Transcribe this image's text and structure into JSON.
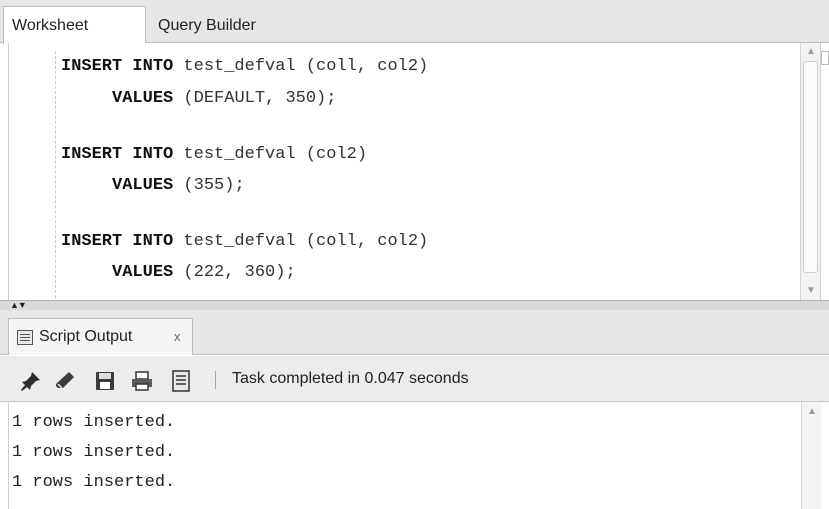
{
  "editor_tabs": [
    {
      "label": "Worksheet",
      "active": true
    },
    {
      "label": "Query Builder",
      "active": false
    }
  ],
  "code": [
    {
      "kw": "INSERT INTO",
      "rest": " test_defval (coll, col2)",
      "indent": ""
    },
    {
      "kw": "VALUES",
      "rest": " (DEFAULT, 350);",
      "indent": "     ",
      "kw2": "DEFAULT"
    },
    {
      "kw": "INSERT INTO",
      "rest": " test_defval (col2)",
      "indent": ""
    },
    {
      "kw": "VALUES",
      "rest": " (355);",
      "indent": "     "
    },
    {
      "kw": "INSERT INTO",
      "rest": " test_defval (coll, col2)",
      "indent": ""
    },
    {
      "kw": "VALUES",
      "rest": " (222, 360);",
      "indent": "     "
    }
  ],
  "output_tab": {
    "label": "Script Output",
    "close": "x",
    "icon": "script-output-icon"
  },
  "toolbar": {
    "icons": [
      "pin-icon",
      "eraser-icon",
      "save-icon",
      "print-icon",
      "document-icon"
    ],
    "status": "Task completed in 0.047 seconds"
  },
  "output_lines": [
    "1 rows inserted.",
    "1 rows inserted.",
    "1 rows inserted."
  ],
  "colors": {
    "chrome": "#e6e6e6",
    "border": "#bdbdbd",
    "editor_bg": "#ffffff"
  }
}
